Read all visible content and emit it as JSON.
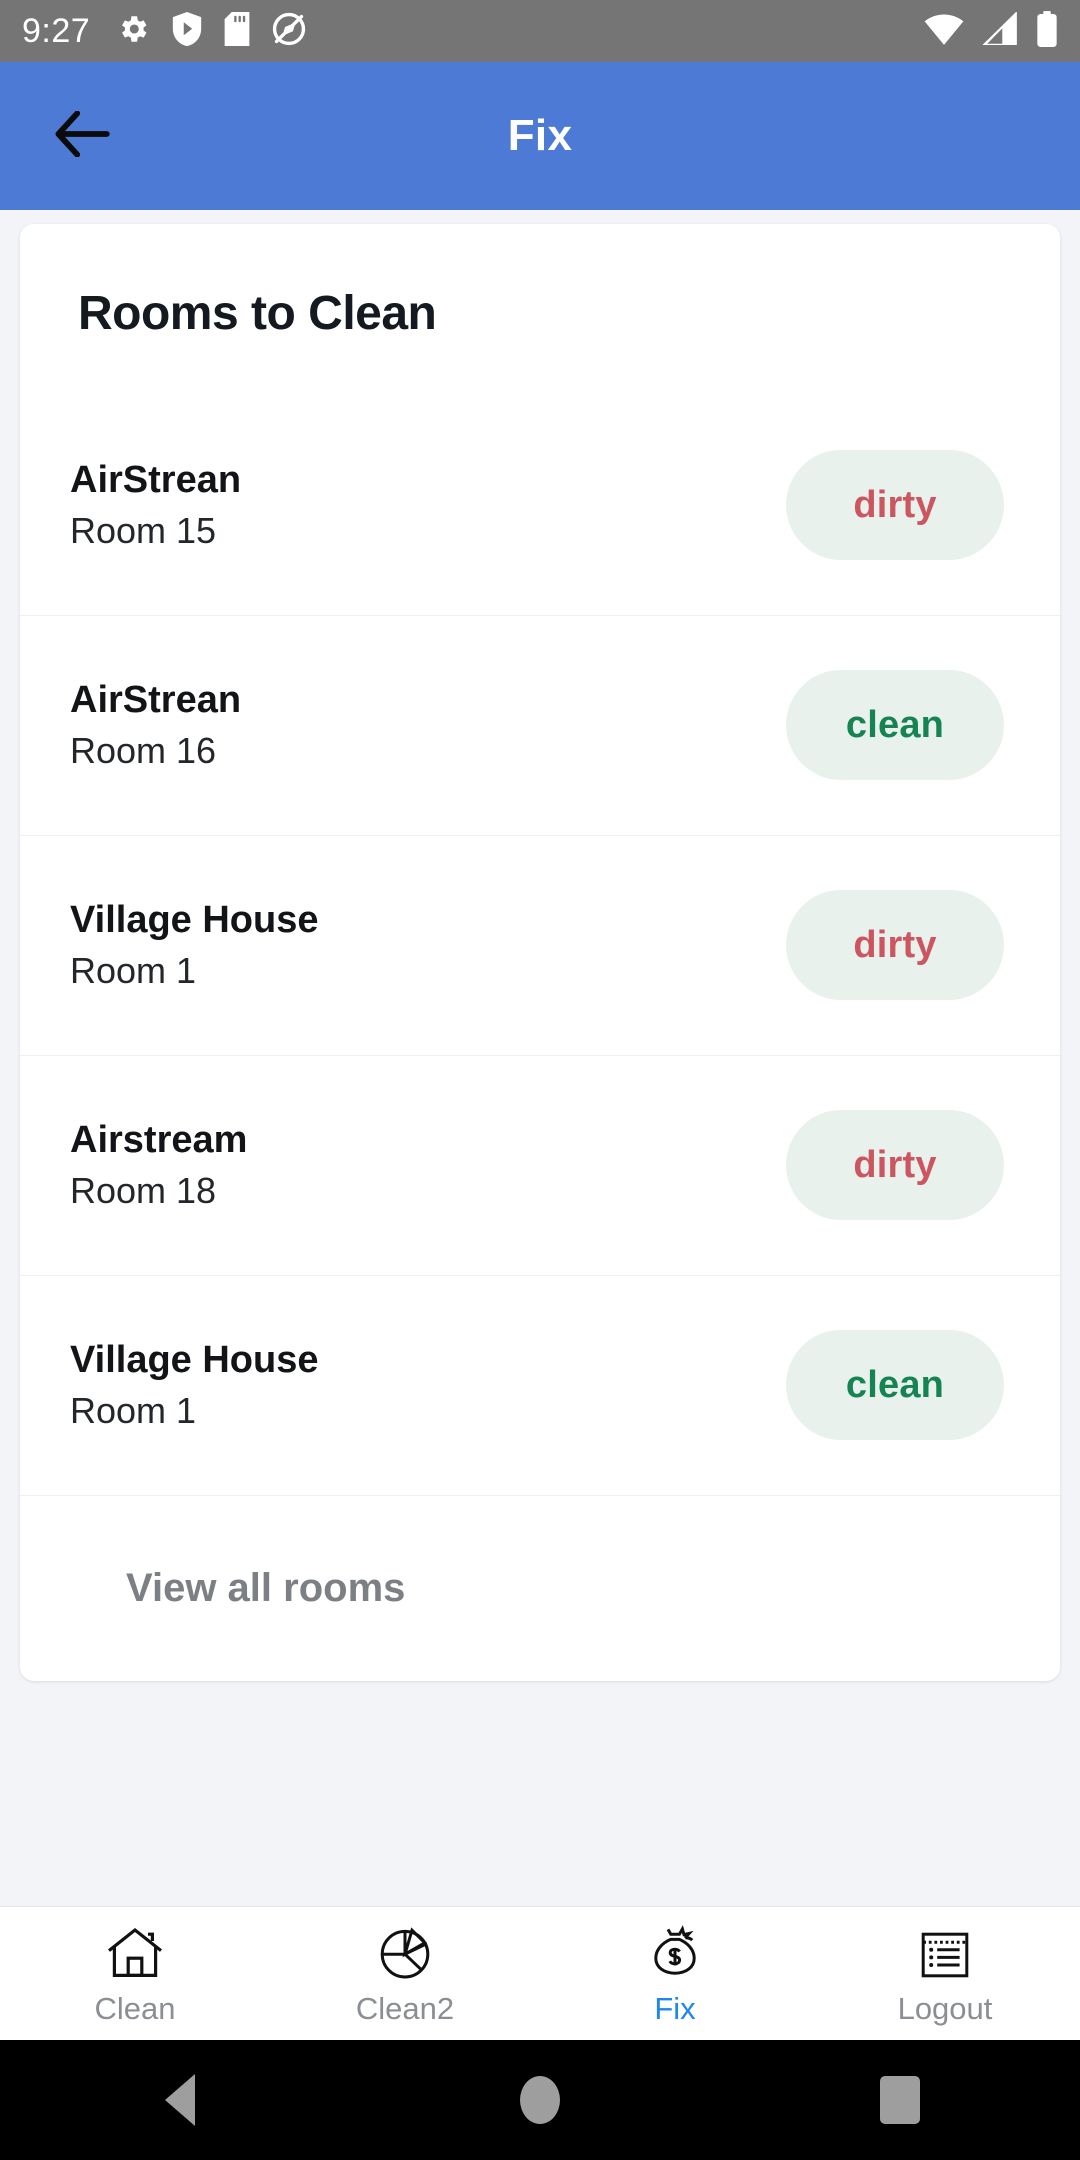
{
  "status_bar": {
    "time": "9:27",
    "left_icons": [
      "gear-icon",
      "play-protect-shield-icon",
      "sd-card-icon",
      "location-off-icon"
    ],
    "right_icons": [
      "wifi-icon",
      "cell-signal-icon",
      "battery-icon"
    ],
    "background_color": "#757575"
  },
  "app_bar": {
    "title": "Fix",
    "back_icon": "arrow-left-icon",
    "background_color": "#4c7ad4",
    "title_color": "#ffffff"
  },
  "card": {
    "title": "Rooms to Clean",
    "rooms": [
      {
        "property": "AirStrean",
        "room": "Room 15",
        "status": "dirty"
      },
      {
        "property": "AirStrean",
        "room": "Room 16",
        "status": "clean"
      },
      {
        "property": "Village House",
        "room": "Room 1",
        "status": "dirty"
      },
      {
        "property": "Airstream",
        "room": "Room 18",
        "status": "dirty"
      },
      {
        "property": "Village House",
        "room": "Room 1",
        "status": "clean"
      }
    ],
    "view_all_label": "View all rooms"
  },
  "colors": {
    "page_background": "#f2f4f8",
    "badge_background": "#e9f1ec",
    "dirty_text": "#cc5560",
    "clean_text": "#158352",
    "accent": "#1e86f0",
    "muted_text": "#8b8f94"
  },
  "bottom_nav": {
    "items": [
      {
        "label": "Clean",
        "icon": "house-icon",
        "active": false
      },
      {
        "label": "Clean2",
        "icon": "pie-chart-icon",
        "active": false
      },
      {
        "label": "Fix",
        "icon": "money-bag-icon",
        "active": true
      },
      {
        "label": "Logout",
        "icon": "list-note-icon",
        "active": false
      }
    ]
  },
  "android_nav": {
    "buttons": [
      "back-triangle-icon",
      "home-circle-icon",
      "recents-square-icon"
    ]
  }
}
